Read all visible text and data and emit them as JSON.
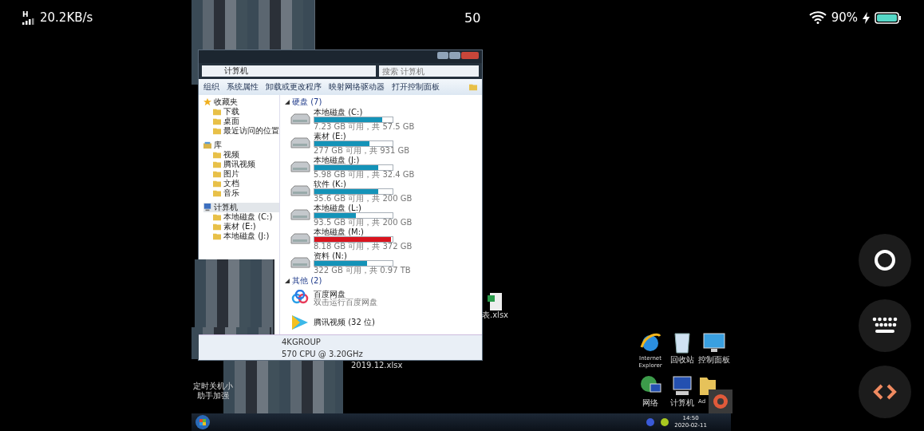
{
  "status_bar": {
    "network": "H",
    "speed": "20.2KB/s",
    "time": "50",
    "battery": "90%"
  },
  "explorer": {
    "address": "计算机",
    "search": {
      "placeholder": "搜索 计算机"
    },
    "toolbar": [
      "组织",
      "系统属性",
      "卸载或更改程序",
      "映射网络驱动器",
      "打开控制面板"
    ],
    "nav": [
      {
        "label": "收藏夹",
        "selected": false,
        "children": [
          {
            "label": "下载",
            "selected": false
          },
          {
            "label": "桌面",
            "selected": false
          },
          {
            "label": "最近访问的位置",
            "selected": false
          }
        ]
      },
      {
        "label": "库",
        "selected": false,
        "children": [
          {
            "label": "视频",
            "selected": false
          },
          {
            "label": "腾讯视频",
            "selected": false
          },
          {
            "label": "图片",
            "selected": false
          },
          {
            "label": "文档",
            "selected": false
          },
          {
            "label": "音乐",
            "selected": false
          }
        ]
      },
      {
        "label": "计算机",
        "selected": true,
        "children": [
          {
            "label": "本地磁盘 (C:)",
            "selected": false
          },
          {
            "label": "素材 (E:)",
            "selected": false
          },
          {
            "label": "本地磁盘 (J:)",
            "selected": false
          }
        ]
      }
    ],
    "groups": [
      {
        "title": "硬盘 (7)",
        "items": [
          {
            "kind": "drive",
            "name": "本地磁盘 (C:)",
            "level": 0.87,
            "color": "#1493b8",
            "info": "7.23 GB 可用，共 57.5 GB"
          },
          {
            "kind": "drive",
            "name": "素材 (E:)",
            "level": 0.7,
            "color": "#1493b8",
            "info": "277 GB 可用，共 931 GB"
          },
          {
            "kind": "drive",
            "name": "本地磁盘 (J:)",
            "level": 0.82,
            "color": "#1493b8",
            "info": "5.98 GB 可用，共 32.4 GB"
          },
          {
            "kind": "drive",
            "name": "软件 (K:)",
            "level": 0.82,
            "color": "#1493b8",
            "info": "35.6 GB 可用，共 200 GB"
          },
          {
            "kind": "drive",
            "name": "本地磁盘 (L:)",
            "level": 0.53,
            "color": "#1493b8",
            "info": "93.5 GB 可用，共 200 GB"
          },
          {
            "kind": "drive",
            "name": "本地磁盘 (M:)",
            "level": 0.98,
            "color": "#d9141e",
            "info": "8.18 GB 可用，共 372 GB"
          },
          {
            "kind": "drive",
            "name": "资料 (N:)",
            "level": 0.67,
            "color": "#1493b8",
            "info": "322 GB 可用，共 0.97 TB"
          }
        ]
      },
      {
        "title": "其他 (2)",
        "items": [
          {
            "kind": "cloud",
            "name": "百度网盘",
            "info": "双击运行百度网盘"
          },
          {
            "kind": "video",
            "name": "腾讯视频 (32 位)"
          }
        ]
      }
    ],
    "details": [
      "4KGROUP",
      "570 CPU @ 3.20GHz"
    ]
  },
  "desktop": {
    "files": [
      {
        "label": "表.xlsx"
      },
      {
        "label": "2019.12.xlsx"
      },
      {
        "label": "定时关机小助手加强"
      }
    ],
    "icons": [
      {
        "kind": "ie",
        "label": "Internet Explorer"
      },
      {
        "kind": "recycle",
        "label": "回收站"
      },
      {
        "kind": "control",
        "label": "控制面板"
      },
      {
        "kind": "network",
        "label": "网络"
      },
      {
        "kind": "computer",
        "label": "计算机"
      },
      {
        "kind": "folder",
        "label": "Ad"
      }
    ]
  },
  "taskbar": {
    "time": "14:50",
    "date": "2020-02-11"
  },
  "floating_buttons": [
    {
      "kind": "ring"
    },
    {
      "kind": "keyboard"
    },
    {
      "kind": "code"
    }
  ]
}
